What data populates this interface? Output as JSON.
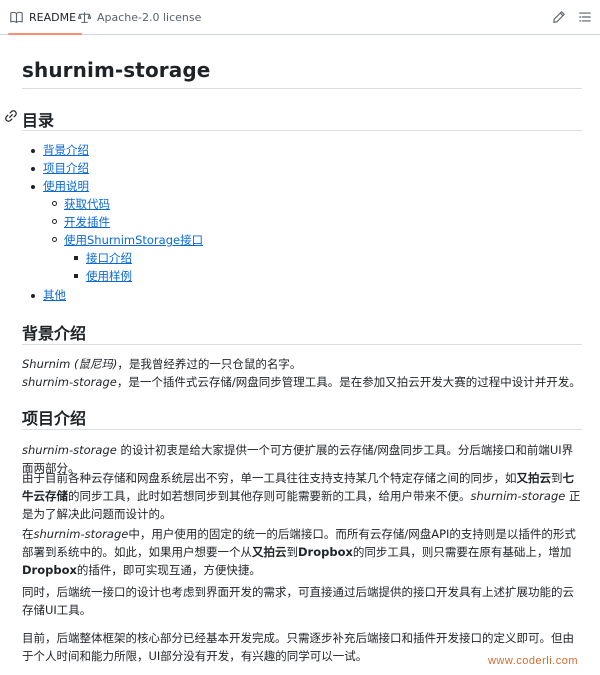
{
  "tabs": {
    "readme": "README",
    "license": "Apache-2.0 license"
  },
  "title": "shurnim-storage",
  "toc": {
    "heading": "目录",
    "items": {
      "bg": "背景介绍",
      "intro": "项目介绍",
      "usage": "使用说明",
      "get_code": "获取代码",
      "dev_plugin": "开发插件",
      "use_api": "使用ShurnimStorage接口",
      "api_intro": "接口介绍",
      "usage_sample": "使用样例",
      "other": "其他"
    }
  },
  "bg_section": {
    "heading": "背景介绍",
    "line1_name": "Shurnim (鼠尼玛)",
    "line1_rest": "，是我曾经养过的一只仓鼠的名字。",
    "line2_name": "shurnim-storage",
    "line2_rest": "，是一个插件式云存储/网盘同步管理工具。是在参加又拍云开发大赛的过程中设计并开发。"
  },
  "intro_section": {
    "heading": "项目介绍",
    "p1_name": "shurnim-storage",
    "p1_rest": " 的设计初衷是给大家提供一个可方便扩展的云存储/网盘同步工具。分后端接口和前端UI界面两部分。",
    "p2_a": "由于目前各种云存储和网盘系统层出不穷，单一工具往往支持支持某几个特定存储之间的同步，如",
    "p2_b1": "又拍云",
    "p2_c": "到",
    "p2_b2": "七牛云存储",
    "p2_d": "的同步工具，此时如若想同步到其他存则可能需要新的工具，给用户带来不便。",
    "p2_name": "shurnim-storage",
    "p2_e": " 正是为了解决此问题而设计的。",
    "p3_a": "在",
    "p3_name": "shurnim-storage",
    "p3_b": "中，用户使用的固定的统一的后端接口。而所有云存储/网盘API的支持则是以插件的形式部署到系统中的。如此，如果用户想要一个从",
    "p3_b1": "又拍云",
    "p3_c": "到",
    "p3_b2": "Dropbox",
    "p3_d": "的同步工具，则只需要在原有基础上，增加",
    "p3_b3": "Dropbox",
    "p3_e": "的插件，即可实现互通，方便快捷。",
    "p4": "同时，后端统一接口的设计也考虑到界面开发的需求，可直接通过后端提供的接口开发具有上述扩展功能的云存储UI工具。",
    "p5": "目前，后端整体框架的核心部分已经基本开发完成。只需逐步补充后端接口和插件开发接口的定义即可。但由于个人时间和能力所限，UI部分没有开发，有兴趣的同学可以一试。"
  },
  "watermark": "www.coderli.com"
}
